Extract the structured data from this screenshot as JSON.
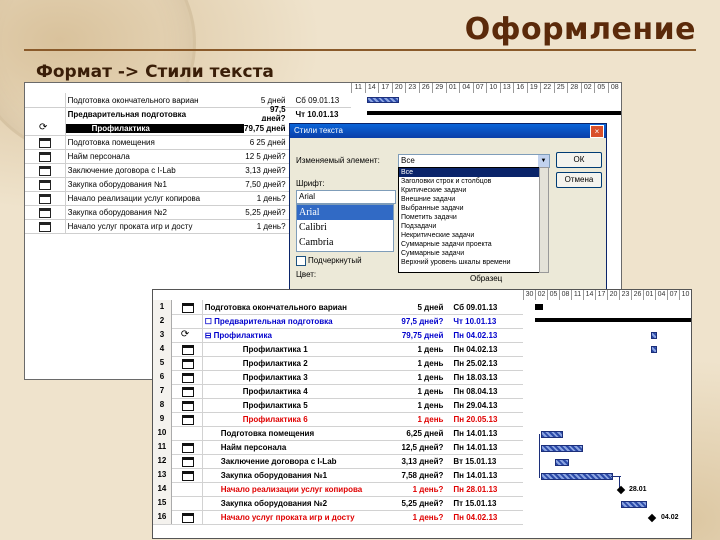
{
  "slide": {
    "title": "Оформление",
    "subtitle": "Формат -> Стили текста"
  },
  "back": {
    "timeline": [
      "11",
      "14",
      "17",
      "20",
      "23",
      "26",
      "29",
      "01",
      "04",
      "07",
      "10",
      "13",
      "16",
      "19",
      "22",
      "25",
      "28",
      "02",
      "05",
      "08"
    ],
    "rows": [
      {
        "name": "Подготовка окончательного вариан",
        "dur": "5 дней",
        "start": "Сб 09.01.13",
        "bold": false
      },
      {
        "name": "Предварительная подготовка",
        "dur": "97,5 дней?",
        "start": "Чт 10.01.13",
        "bold": true
      },
      {
        "name": "Профилактика",
        "dur": "79,75 дней",
        "start": "",
        "bold": true,
        "selected": true
      },
      {
        "name": "Подготовка помещения",
        "dur": "6 25 дней",
        "start": "",
        "bold": false
      },
      {
        "name": "Найм персонала",
        "dur": "12 5 дней?",
        "start": "",
        "bold": false
      },
      {
        "name": "Заключение договора с I-Lab",
        "dur": "3,13 дней?",
        "start": "",
        "bold": false
      },
      {
        "name": "Закупка оборудования №1",
        "dur": "7,50 дней?",
        "start": "",
        "bold": false
      },
      {
        "name": "Начало реализации услуг копирова",
        "dur": "1 день?",
        "start": "",
        "bold": false
      },
      {
        "name": "Закупка оборудования №2",
        "dur": "5,25 дней?",
        "start": "",
        "bold": false
      },
      {
        "name": "Начало услуг проката игр и досту",
        "dur": "1 день?",
        "start": "",
        "bold": false
      }
    ]
  },
  "dialog": {
    "title": "Стили текста",
    "close": "×",
    "item_label": "Изменяемый элемент:",
    "item_value": "Все",
    "font_label": "Шрифт:",
    "font_value": "Arial",
    "fonts": [
      "Arial",
      "Calibri",
      "Cambria"
    ],
    "underline_label": "Подчеркнутый",
    "color_label": "Цвет:",
    "sample_label": "Образец",
    "ok": "ОК",
    "cancel": "Отмена",
    "options": [
      "Все",
      "Заголовки строк и столбцов",
      "Критические задачи",
      "Внешние задачи",
      "Выбранные задачи",
      "Пометить задачи",
      "Подзадачи",
      "Некритические задачи",
      "Суммарные задачи проекта",
      "Суммарные задачи",
      "Верхний уровень шкалы времени"
    ]
  },
  "front": {
    "timeline": [
      "30",
      "02",
      "05",
      "08",
      "11",
      "14",
      "17",
      "20",
      "23",
      "26",
      "01",
      "04",
      "07",
      "10"
    ],
    "rows": [
      {
        "id": "1",
        "name": "Подготовка окончательного вариан",
        "dur": "5 дней",
        "start": "Сб 09.01.13",
        "color": "black",
        "icon": "task"
      },
      {
        "id": "2",
        "name": "☐ Предварительная подготовка",
        "dur": "97,5 дней?",
        "start": "Чт 10.01.13",
        "color": "blue",
        "icon": "none"
      },
      {
        "id": "3",
        "name": "⊟ Профилактика",
        "dur": "79,75 дней",
        "start": "Пн 04.02.13",
        "color": "blue",
        "icon": "recur"
      },
      {
        "id": "4",
        "name": "Профилактика 1",
        "dur": "1 день",
        "start": "Пн 04.02.13",
        "color": "black",
        "icon": "task"
      },
      {
        "id": "5",
        "name": "Профилактика 2",
        "dur": "1 день",
        "start": "Пн 25.02.13",
        "color": "black",
        "icon": "task"
      },
      {
        "id": "6",
        "name": "Профилактика 3",
        "dur": "1 день",
        "start": "Пн 18.03.13",
        "color": "black",
        "icon": "task"
      },
      {
        "id": "7",
        "name": "Профилактика 4",
        "dur": "1 день",
        "start": "Пн 08.04.13",
        "color": "black",
        "icon": "task"
      },
      {
        "id": "8",
        "name": "Профилактика 5",
        "dur": "1 день",
        "start": "Пн 29.04.13",
        "color": "black",
        "icon": "task"
      },
      {
        "id": "9",
        "name": "Профилактика 6",
        "dur": "1 день",
        "start": "Пн 20.05.13",
        "color": "red",
        "icon": "task"
      },
      {
        "id": "10",
        "name": "Подготовка помещения",
        "dur": "6,25 дней",
        "start": "Пн 14.01.13",
        "color": "black",
        "icon": "none"
      },
      {
        "id": "11",
        "name": "Найм персонала",
        "dur": "12,5 дней?",
        "start": "Пн 14.01.13",
        "color": "black",
        "icon": "task"
      },
      {
        "id": "12",
        "name": "Заключение договора с I-Lab",
        "dur": "3,13 дней?",
        "start": "Вт 15.01.13",
        "color": "black",
        "icon": "task"
      },
      {
        "id": "13",
        "name": "Закупка оборудования №1",
        "dur": "7,58 дней?",
        "start": "Пн 14.01.13",
        "color": "black",
        "icon": "task"
      },
      {
        "id": "14",
        "name": "Начало реализации услуг копирова",
        "dur": "1 день?",
        "start": "Пн 28.01.13",
        "color": "red",
        "icon": "none"
      },
      {
        "id": "15",
        "name": "Закупка оборудования №2",
        "dur": "5,25 дней?",
        "start": "Пт 15.01.13",
        "color": "black",
        "icon": "none"
      },
      {
        "id": "16",
        "name": "Начало услуг проката игр и досту",
        "dur": "1 день?",
        "start": "Пн 04.02.13",
        "color": "red",
        "icon": "task"
      }
    ],
    "milestones": [
      "28.01",
      "04.02"
    ]
  }
}
